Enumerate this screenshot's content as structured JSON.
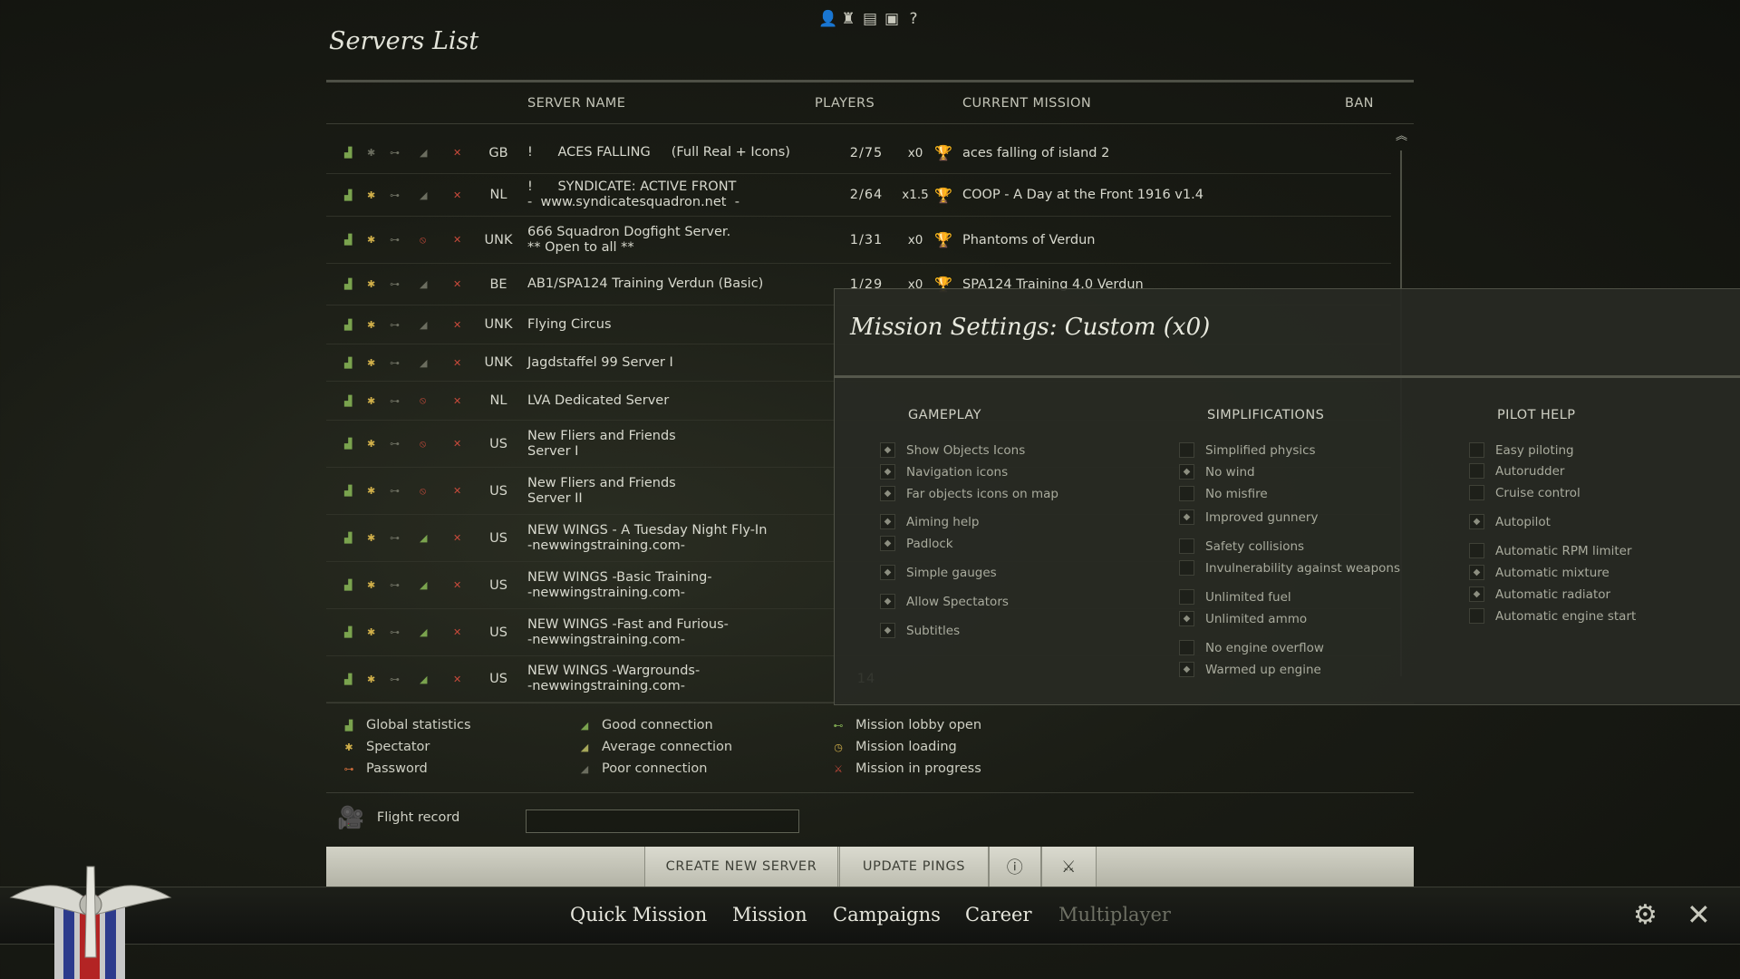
{
  "page": {
    "title": "Servers List"
  },
  "top_icons": [
    "person-icon",
    "trophy-icon",
    "book-icon",
    "film-icon",
    "help-icon"
  ],
  "columns": {
    "server_name": "SERVER NAME",
    "players": "PLAYERS",
    "current_mission": "CURRENT MISSION",
    "ban": "BAN"
  },
  "servers": [
    {
      "country": "GB",
      "name1": "!      ACES FALLING     (Full Real + Icons)",
      "name2": "",
      "players": "2/75",
      "mult": "x0",
      "mission": "aces falling of island 2"
    },
    {
      "country": "NL",
      "name1": "!      SYNDICATE: ACTIVE FRONT",
      "name2": "-  www.syndicatesquadron.net  -",
      "players": "2/64",
      "mult": "x1.5",
      "mission": "COOP - A Day at the Front 1916 v1.4"
    },
    {
      "country": "UNK",
      "name1": "666 Squadron Dogfight Server.",
      "name2": "** Open to all **",
      "players": "1/31",
      "mult": "x0",
      "mission": "Phantoms of Verdun"
    },
    {
      "country": "BE",
      "name1": "AB1/SPA124 Training Verdun (Basic)",
      "name2": "",
      "players": "1/29",
      "mult": "x0",
      "mission": "SPA124 Training 4.0 Verdun"
    },
    {
      "country": "UNK",
      "name1": "Flying Circus",
      "name2": "",
      "players": "",
      "mult": "",
      "mission": ""
    },
    {
      "country": "UNK",
      "name1": "Jagdstaffel 99 Server I",
      "name2": "",
      "players": "",
      "mult": "",
      "mission": ""
    },
    {
      "country": "NL",
      "name1": "LVA Dedicated Server",
      "name2": "",
      "players": "",
      "mult": "",
      "mission": ""
    },
    {
      "country": "US",
      "name1": "New Fliers and Friends",
      "name2": "Server I",
      "players": "",
      "mult": "",
      "mission": ""
    },
    {
      "country": "US",
      "name1": "New Fliers and Friends",
      "name2": "Server II",
      "players": "",
      "mult": "",
      "mission": ""
    },
    {
      "country": "US",
      "name1": "NEW WINGS - A Tuesday Night Fly-In",
      "name2": "-newwingstraining.com-",
      "players": "",
      "mult": "",
      "mission": ""
    },
    {
      "country": "US",
      "name1": "NEW WINGS -Basic Training-",
      "name2": "-newwingstraining.com-",
      "players": "",
      "mult": "",
      "mission": ""
    },
    {
      "country": "US",
      "name1": "NEW WINGS -Fast and Furious-",
      "name2": "-newwingstraining.com-",
      "players": "",
      "mult": "",
      "mission": ""
    },
    {
      "country": "US",
      "name1": "NEW WINGS -Wargrounds-",
      "name2": "-newwingstraining.com-",
      "players": "14",
      "mult": "",
      "mission": ""
    }
  ],
  "legend": {
    "global_statistics": "Global statistics",
    "spectator": "Spectator",
    "password": "Password",
    "good_connection": "Good connection",
    "average_connection": "Average connection",
    "poor_connection": "Poor connection",
    "mission_lobby_open": "Mission lobby open",
    "mission_loading": "Mission loading",
    "mission_in_progress": "Mission in progress"
  },
  "flight_record": {
    "label": "Flight record",
    "value": ""
  },
  "toolbar": {
    "create_server": "CREATE NEW SERVER",
    "update_pings": "UPDATE PINGS"
  },
  "nav": {
    "quick_mission": "Quick Mission",
    "mission": "Mission",
    "campaigns": "Campaigns",
    "career": "Career",
    "multiplayer": "Multiplayer"
  },
  "mission_settings": {
    "title": "Mission Settings: Custom (x0)",
    "gameplay": {
      "heading": "GAMEPLAY",
      "options": [
        {
          "label": "Show Objects Icons",
          "on": true
        },
        {
          "label": "Navigation icons",
          "on": true
        },
        {
          "label": "Far objects icons on map",
          "on": true
        },
        {
          "label": "Aiming help",
          "on": true
        },
        {
          "label": "Padlock",
          "on": true
        },
        {
          "label": "Simple gauges",
          "on": true
        },
        {
          "label": "Allow Spectators",
          "on": true
        },
        {
          "label": "Subtitles",
          "on": true
        }
      ]
    },
    "simplifications": {
      "heading": "SIMPLIFICATIONS",
      "options": [
        {
          "label": "Simplified physics",
          "on": false
        },
        {
          "label": "No wind",
          "on": true
        },
        {
          "label": "No misfire",
          "on": false
        },
        {
          "label": "Improved gunnery",
          "on": true
        },
        {
          "label": "Safety collisions",
          "on": false
        },
        {
          "label": "Invulnerability against weapons",
          "on": false
        },
        {
          "label": "Unlimited fuel",
          "on": false
        },
        {
          "label": "Unlimited ammo",
          "on": true
        },
        {
          "label": "No engine overflow",
          "on": false
        },
        {
          "label": "Warmed up engine",
          "on": true
        }
      ]
    },
    "pilot_help": {
      "heading": "PILOT HELP",
      "options": [
        {
          "label": "Easy piloting",
          "on": false
        },
        {
          "label": "Autorudder",
          "on": false
        },
        {
          "label": "Cruise control",
          "on": false
        },
        {
          "label": "Autopilot",
          "on": true
        },
        {
          "label": "Automatic RPM limiter",
          "on": false
        },
        {
          "label": "Automatic mixture",
          "on": true
        },
        {
          "label": "Automatic radiator",
          "on": true
        },
        {
          "label": "Automatic engine start",
          "on": false
        }
      ]
    }
  }
}
